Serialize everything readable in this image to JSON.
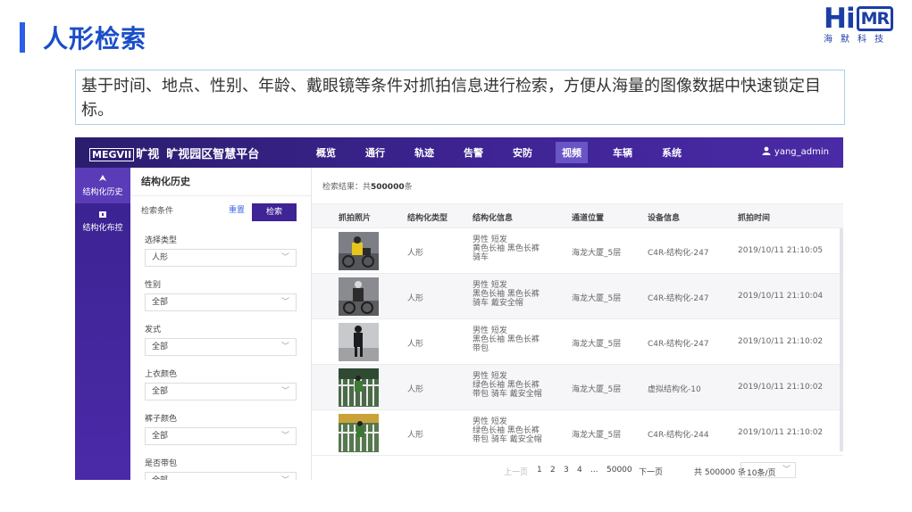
{
  "slide": {
    "title": "人形检索",
    "logo_main": "Hi",
    "logo_box": "MR",
    "logo_sub": "海默科技",
    "description": "基于时间、地点、性别、年龄、戴眼镜等条件对抓拍信息进行检索，方便从海量的图像数据中快速锁定目标。"
  },
  "colors": {
    "title_blue": "#1a4ec8",
    "nav_purple": "#3e2494",
    "active_purple": "#6a55c7",
    "link_blue": "#3b6ae3"
  },
  "app": {
    "brand_logo": "MEGVII",
    "brand_cn": "旷视",
    "platform": "旷视园区智慧平台",
    "nav": [
      "概览",
      "通行",
      "轨迹",
      "告警",
      "安防",
      "视频",
      "车辆",
      "系统"
    ],
    "nav_active": "视频",
    "user": "yang_admin",
    "user_icon": "user-icon",
    "side": [
      {
        "label": "结构化历史",
        "icon": "structured-history-icon"
      },
      {
        "label": "结构化布控",
        "icon": "structured-control-icon"
      }
    ],
    "filter": {
      "heading": "结构化历史",
      "cond_label": "检索条件",
      "reset": "重置",
      "search": "检索",
      "fields": [
        {
          "label": "选择类型",
          "value": "人形"
        },
        {
          "label": "性别",
          "value": "全部"
        },
        {
          "label": "发式",
          "value": "全部"
        },
        {
          "label": "上衣颜色",
          "value": "全部"
        },
        {
          "label": "裤子颜色",
          "value": "全部"
        },
        {
          "label": "是否带包",
          "value": "全部"
        }
      ]
    },
    "results": {
      "count_label": "检索结果：共",
      "count_value": "500000",
      "count_unit": "条",
      "columns": [
        "抓拍照片",
        "结构化类型",
        "结构化信息",
        "通道位置",
        "设备信息",
        "抓拍时间"
      ],
      "rows": [
        {
          "type": "人形",
          "info": [
            "男性 短发",
            "黄色长袖 黑色长裤",
            "骑车"
          ],
          "location": "海龙大厦_5层",
          "device": "C4R-结构化-247",
          "time": "2019/10/11 21:10:05"
        },
        {
          "type": "人形",
          "info": [
            "男性 短发",
            "黑色长袖 黑色长裤",
            "骑车 戴安全帽"
          ],
          "location": "海龙大厦_5层",
          "device": "C4R-结构化-247",
          "time": "2019/10/11 21:10:04"
        },
        {
          "type": "人形",
          "info": [
            "男性 短发",
            "黑色长袖 黑色长裤",
            "带包"
          ],
          "location": "海龙大厦_5层",
          "device": "C4R-结构化-247",
          "time": "2019/10/11 21:10:02"
        },
        {
          "type": "人形",
          "info": [
            "男性 短发",
            "绿色长袖 黑色长裤",
            "带包 骑车 戴安全帽"
          ],
          "location": "海龙大厦_5层",
          "device": "虚拟结构化-10",
          "time": "2019/10/11 21:10:02"
        },
        {
          "type": "人形",
          "info": [
            "男性 短发",
            "绿色长袖 黑色长裤",
            "带包 骑车 戴安全帽"
          ],
          "location": "海龙大厦_5层",
          "device": "C4R-结构化-244",
          "time": "2019/10/11 21:10:02"
        }
      ]
    },
    "pager": {
      "prev": "上一页",
      "pages": [
        "1",
        "2",
        "3",
        "4",
        "...",
        "50000"
      ],
      "next": "下一页",
      "total": "共 500000 条",
      "page_size": "10条/页"
    }
  }
}
